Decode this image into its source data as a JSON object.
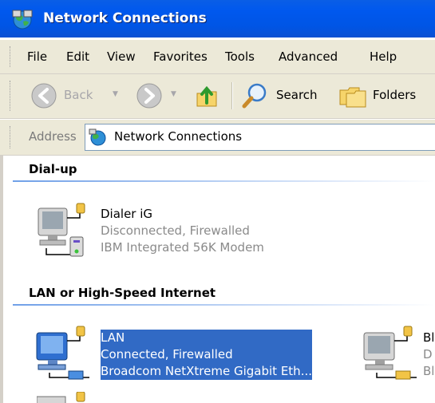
{
  "window": {
    "title": "Network Connections"
  },
  "menu": {
    "items": [
      "File",
      "Edit",
      "View",
      "Favorites",
      "Tools",
      "Advanced",
      "Help"
    ]
  },
  "toolbar": {
    "back_label": "Back",
    "search_label": "Search",
    "folders_label": "Folders"
  },
  "address": {
    "label": "Address",
    "value": "Network Connections"
  },
  "groups": [
    {
      "header": "Dial-up",
      "connections": [
        {
          "name": "Dialer iG",
          "status": "Disconnected, Firewalled",
          "device": "IBM Integrated 56K Modem",
          "icon": "modem-connection-icon"
        }
      ]
    },
    {
      "header": "LAN or High-Speed Internet",
      "connections": [
        {
          "name": "LAN",
          "status": "Connected, Firewalled",
          "device": "Broadcom NetXtreme Gigabit Eth...",
          "icon": "lan-connection-icon",
          "selected": true
        },
        {
          "name": "Bl",
          "status": "D",
          "device": "Bl",
          "icon": "lan-connection-icon"
        }
      ]
    }
  ],
  "colors": {
    "titlebar": "#0055e5",
    "selection": "#316ac5",
    "chrome": "#ece9d8"
  }
}
